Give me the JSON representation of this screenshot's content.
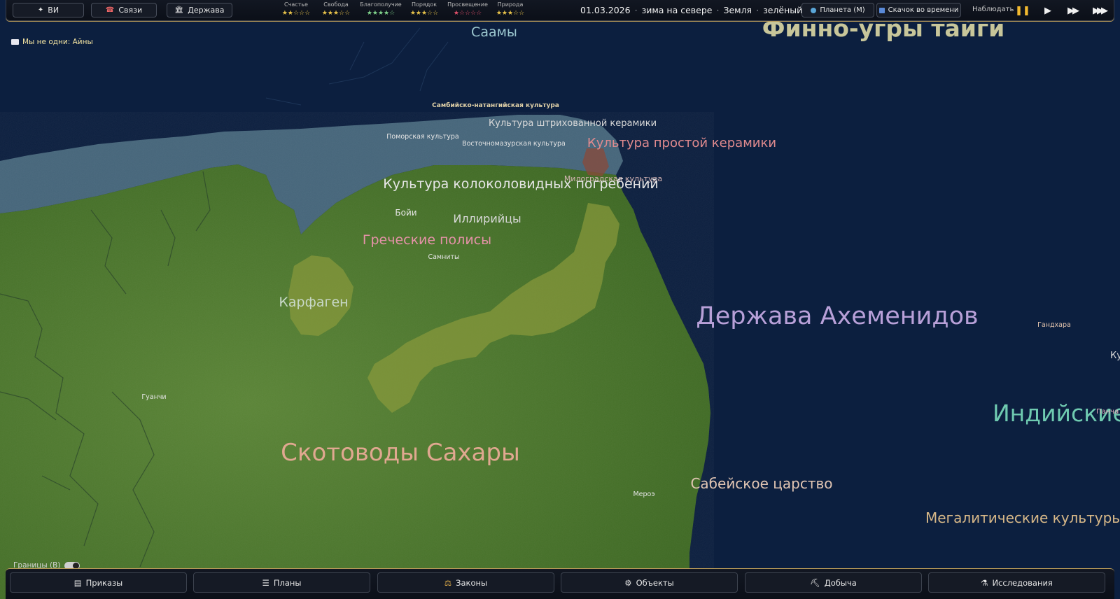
{
  "topbar": {
    "buttons": [
      {
        "label": "ВИ",
        "icon": "sparkle-icon"
      },
      {
        "label": "Связи",
        "icon": "phone-icon"
      },
      {
        "label": "Держава",
        "icon": "bank-icon"
      }
    ],
    "stats": [
      {
        "name": "Счастье",
        "stars": "★★☆☆☆",
        "color": "#e7c24a"
      },
      {
        "name": "Свобода",
        "stars": "★★★☆☆",
        "color": "#e7c24a"
      },
      {
        "name": "Благополучие",
        "stars": "★★★★☆",
        "color": "#7fd18a"
      },
      {
        "name": "Порядок",
        "stars": "★★★☆☆",
        "color": "#e7c24a"
      },
      {
        "name": "Просвещение",
        "stars": "★☆☆☆☆",
        "color": "#e0506a"
      },
      {
        "name": "Природа",
        "stars": "★★★☆☆",
        "color": "#e7c24a"
      }
    ],
    "date": "01.03.2026",
    "season": "зима на севере",
    "world": "Земля",
    "world_type": "зелёный мир",
    "planet_button": "Планета (М)",
    "time_jump_button": "Скачок во времени",
    "watch_label": "Наблюдать",
    "controls": [
      "pause-icon",
      "play-icon",
      "fast-forward-icon",
      "fastest-forward-icon"
    ]
  },
  "notice": "Мы не одни: Айны",
  "borders_toggle": "Границы (B)",
  "map_labels": {
    "saamy": "Саамы",
    "finno_ugry": "Финно-угры тайги",
    "sambiysko": "Самбийско-натангийская культура",
    "shtrikh": "Культура штрихованной керамики",
    "pomorskaya": "Поморская культура",
    "vostochno": "Восточномазурская культура",
    "prostoy": "Культура простой керамики",
    "milograd": "Милоградская культура",
    "kolokol": "Культура колоколовидных погребений",
    "boii": "Бойи",
    "illiriytsy": "Иллирийцы",
    "grecheskie": "Греческие полисы",
    "samnity": "Самниты",
    "karfagen": "Карфаген",
    "akhemenid": "Держава Ахеменидов",
    "gandkhara": "Гандхара",
    "kush": "Ку",
    "indiyskie": "Индийские",
    "panch": "Панча",
    "guanchi": "Гуанчи",
    "skotovody": "Скотоводы Сахары",
    "saba": "Сабейское царство",
    "meroe": "Мероэ",
    "megalit": "Мегалитические культуры"
  },
  "bottombar": [
    {
      "label": "Приказы",
      "icon": "list-icon"
    },
    {
      "label": "Планы",
      "icon": "menu-icon"
    },
    {
      "label": "Законы",
      "icon": "scales-icon"
    },
    {
      "label": "Объекты",
      "icon": "gear-icon"
    },
    {
      "label": "Добыча",
      "icon": "pickaxe-icon"
    },
    {
      "label": "Исследования",
      "icon": "flask-icon"
    }
  ],
  "colors": {
    "ocean": "#0c1f3f",
    "land": "#4f7a2e",
    "ice": "#4d6e82",
    "accent": "#b89a58"
  }
}
